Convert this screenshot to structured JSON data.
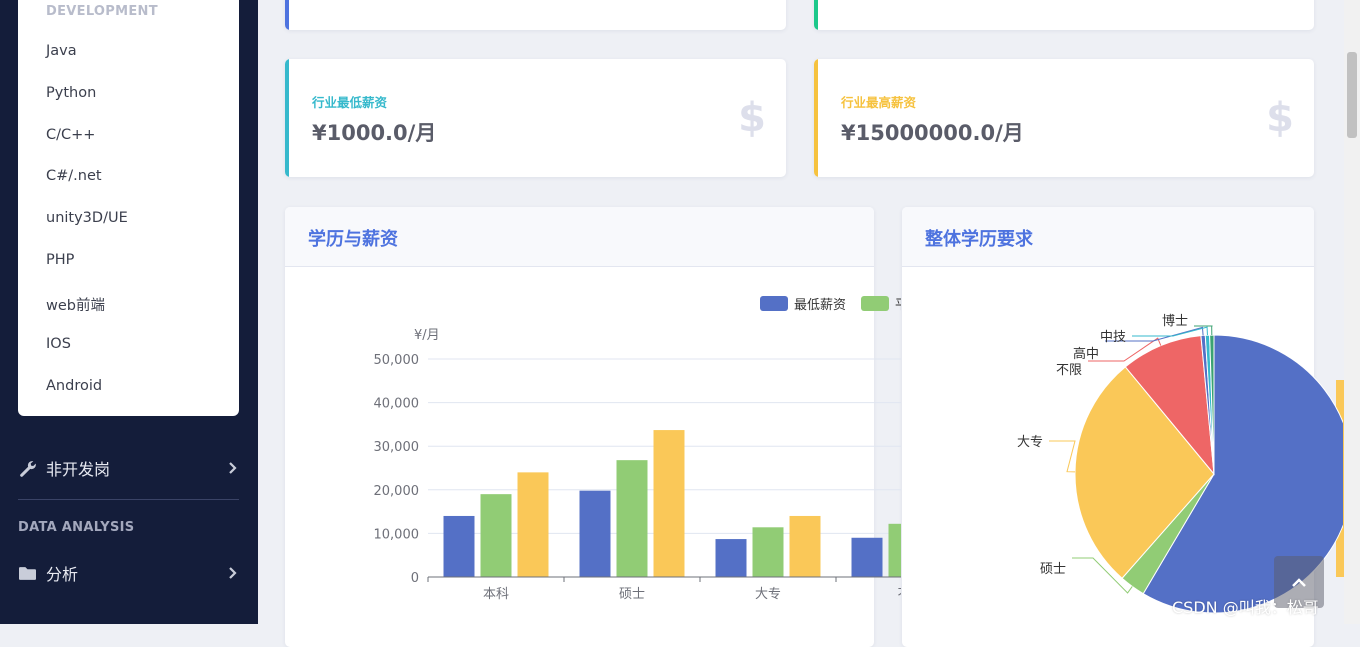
{
  "sidebar": {
    "dev_heading": "DEVELOPMENT",
    "dev_items": [
      "Java",
      "Python",
      "C/C++",
      "C#/.net",
      "unity3D/UE",
      "PHP",
      "web前端",
      "IOS",
      "Android"
    ],
    "nondev_label": "非开发岗",
    "analysis_heading": "DATA ANALYSIS",
    "analysis_label": "分析"
  },
  "stats": {
    "min_label": "行业最低薪资",
    "min_value": "¥1000.0/月",
    "max_label": "行业最高薪资",
    "max_value": "¥15000000.0/月",
    "icon": "dollar-icon"
  },
  "colors": {
    "blue": "#5470c6",
    "green": "#91cc75",
    "yellow": "#fac858",
    "red": "#ee6666",
    "teal": "#36b9cc",
    "gold": "#f6c23e"
  },
  "panels": {
    "salary_title": "学历与薪资",
    "edu_title": "整体学历要求"
  },
  "watermark": "CSDN @叫我：松哥",
  "chart_data": [
    {
      "type": "bar",
      "title": "学历与薪资",
      "ylabel": "¥/月",
      "ylim": [
        0,
        50000
      ],
      "yticks": [
        "0",
        "10,000",
        "20,000",
        "30,000",
        "40,000",
        "50,000"
      ],
      "categories": [
        "本科",
        "硕士",
        "大专",
        "不"
      ],
      "series": [
        {
          "name": "最低薪资",
          "values": [
            14000,
            19800,
            8700,
            9000
          ]
        },
        {
          "name": "平",
          "values": [
            19000,
            26800,
            11400,
            12200
          ]
        },
        {
          "values": [
            24000,
            33700,
            14000,
            null
          ]
        }
      ],
      "legend": "top-right"
    },
    {
      "type": "pie",
      "title": "整体学历要求",
      "slices": [
        {
          "label": "",
          "value": 58.5
        },
        {
          "label": "硕士",
          "value": 3.0
        },
        {
          "label": "大专",
          "value": 27.5
        },
        {
          "label": "不限",
          "value": 9.5
        },
        {
          "label": "高中",
          "value": 0.5
        },
        {
          "label": "中技",
          "value": 0.5
        },
        {
          "label": "博士",
          "value": 0.5
        }
      ]
    }
  ]
}
